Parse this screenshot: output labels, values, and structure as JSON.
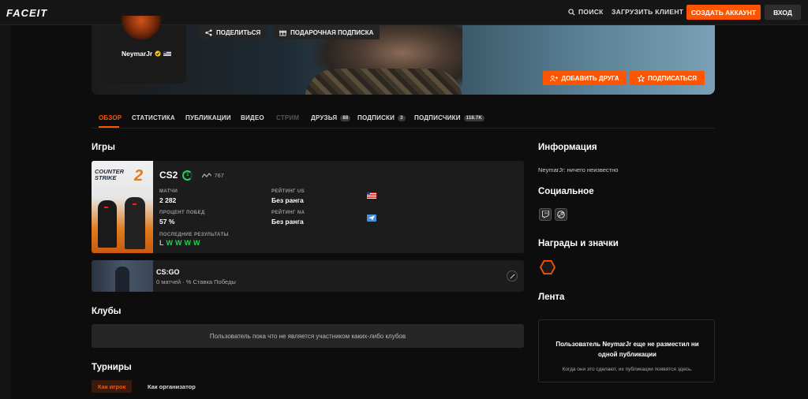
{
  "header": {
    "logo": "FACEIT",
    "search_label": "ПОИСК",
    "download_label": "ЗАГРУЗИТЬ КЛИЕНТ",
    "create_account_label": "СОЗДАТЬ АККАУНТ",
    "login_label": "ВХОД"
  },
  "profile": {
    "nickname": "NeymarJr",
    "share_label": "ПОДЕЛИТЬСЯ",
    "gift_label": "ПОДАРОЧНАЯ ПОДПИСКА",
    "add_friend_label": "ДОБАВИТЬ ДРУГА",
    "subscribe_label": "ПОДПИСАТЬСЯ"
  },
  "tabs": [
    {
      "label": "ОБЗОР",
      "badge": ""
    },
    {
      "label": "СТАТИСТИКА",
      "badge": ""
    },
    {
      "label": "ПУБЛИКАЦИИ",
      "badge": ""
    },
    {
      "label": "ВИДЕО",
      "badge": ""
    },
    {
      "label": "СТРИМ",
      "badge": ""
    },
    {
      "label": "ДРУЗЬЯ",
      "badge": "88"
    },
    {
      "label": "ПОДПИСКИ",
      "badge": "3"
    },
    {
      "label": "ПОДПИСЧИКИ",
      "badge": "118.7K"
    }
  ],
  "games": {
    "heading": "Игры",
    "cs2": {
      "art_text_1": "COUNTER",
      "art_text_2": "STRIKE",
      "art_number": "2",
      "title": "CS2",
      "level": "1",
      "elo": "767",
      "matches_label": "МАТЧИ",
      "matches_value": "2 282",
      "winrate_label": "ПРОЦЕНТ ПОБЕД",
      "winrate_value": "57 %",
      "recent_label": "ПОСЛЕДНИЕ РЕЗУЛЬТАТЫ",
      "recent_results": [
        "L",
        "W",
        "W",
        "W",
        "W"
      ],
      "rating_us_label": "РЕЙТИНГ US",
      "rating_us_value": "Без ранга",
      "rating_na_label": "РЕЙТИНГ NA",
      "rating_na_value": "Без ранга"
    },
    "csgo": {
      "title": "CS:GO",
      "subtitle": "0 матчей · % Ставка Победы"
    }
  },
  "clubs": {
    "heading": "Клубы",
    "empty_text": "Пользователь пока что не является участником каких-либо клубов"
  },
  "tournaments": {
    "heading": "Турниры",
    "tab_player": "Как игрок",
    "tab_organizer": "Как организатор"
  },
  "sidebar": {
    "info_heading": "Информация",
    "info_text": "NeymarJr: ничего неизвестно",
    "social_heading": "Социальное",
    "awards_heading": "Награды и значки",
    "feed_heading": "Лента",
    "feed_title": "Пользователь NeymarJr еще не разместил ни одной публикации",
    "feed_sub": "Когда они это сделают, их публикации появятся здесь."
  },
  "colors": {
    "accent": "#ff5500",
    "win": "#1fd654"
  }
}
